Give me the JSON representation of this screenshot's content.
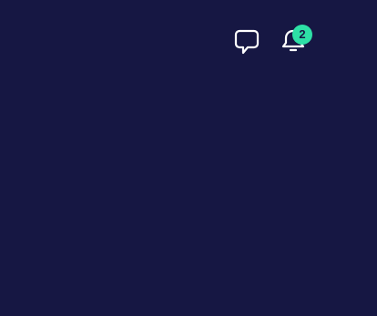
{
  "header": {
    "messages_icon": "chat-bubble-icon",
    "notifications_icon": "bell-icon",
    "notifications_count": "2"
  },
  "colors": {
    "background": "#161743",
    "icon": "#ffffff",
    "badge": "#2ee0a6",
    "badge_text": "#161743"
  }
}
